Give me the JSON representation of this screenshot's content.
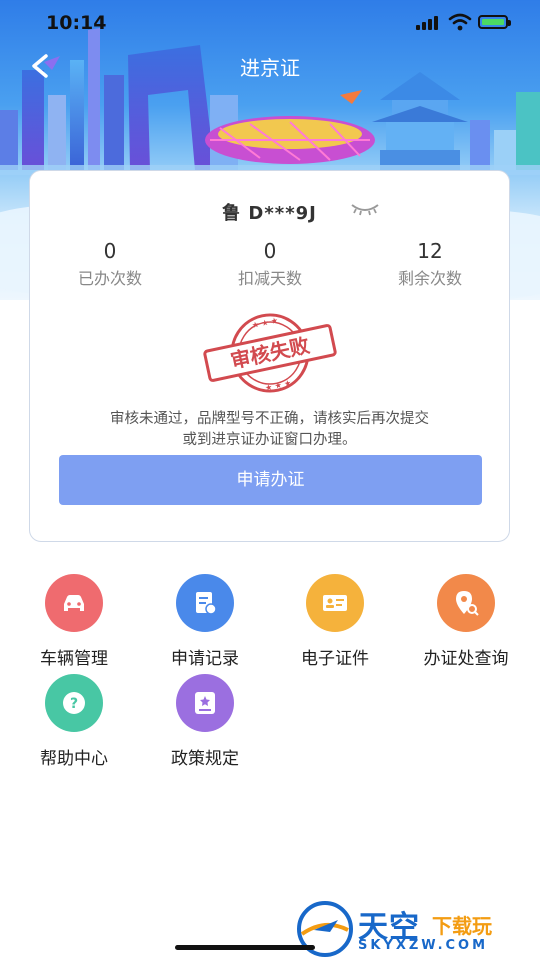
{
  "status": {
    "time": "10:14"
  },
  "nav": {
    "title": "进京证"
  },
  "vehicle": {
    "plate": "鲁 D***9J"
  },
  "stats": [
    {
      "value": "0",
      "label": "已办次数"
    },
    {
      "value": "0",
      "label": "扣减天数"
    },
    {
      "value": "12",
      "label": "剩余次数"
    }
  ],
  "stamp": {
    "text": "审核失败"
  },
  "message": {
    "line1": "审核未通过，品牌型号不正确，请核实后再次提交",
    "line2": "或到进京证办证窗口办理。"
  },
  "apply_button": {
    "label": "申请办证"
  },
  "menu": [
    {
      "label": "车辆管理",
      "icon": "car-icon",
      "color": "#ef6b6f"
    },
    {
      "label": "申请记录",
      "icon": "document-icon",
      "color": "#4a89ea"
    },
    {
      "label": "电子证件",
      "icon": "id-card-icon",
      "color": "#f5b23c"
    },
    {
      "label": "办证处查询",
      "icon": "location-search-icon",
      "color": "#f2894a"
    },
    {
      "label": "帮助中心",
      "icon": "help-icon",
      "color": "#48c7a4"
    },
    {
      "label": "政策规定",
      "icon": "policy-book-icon",
      "color": "#9b6fe0"
    }
  ],
  "watermark": {
    "brand": "天空",
    "tag": "下载玩",
    "url": "SKYXZW.COM"
  }
}
